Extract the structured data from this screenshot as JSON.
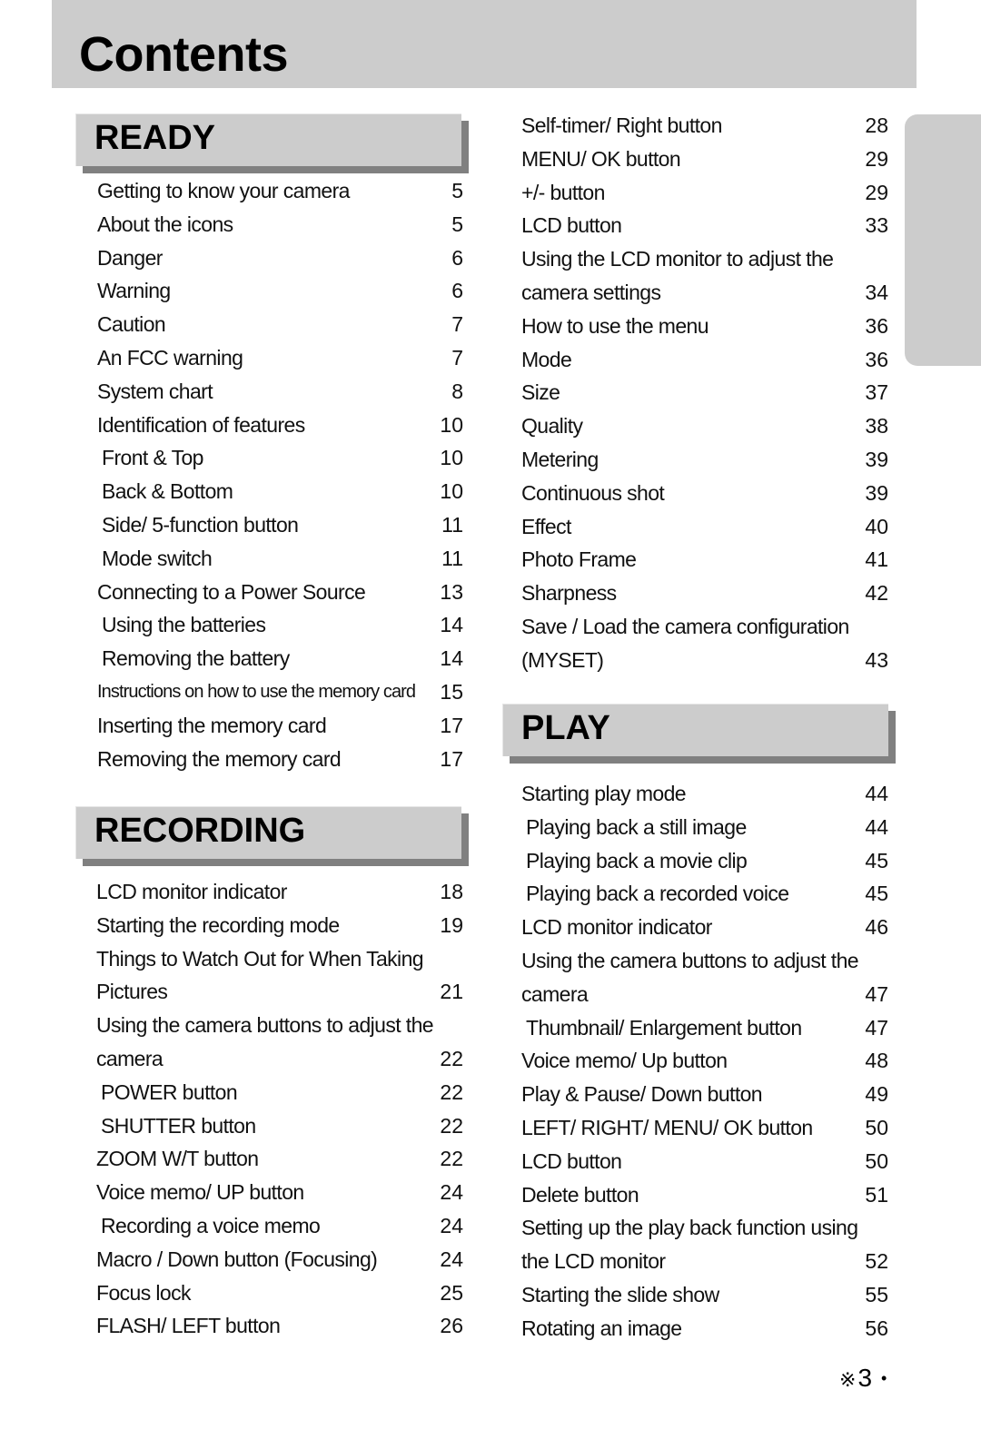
{
  "page_title": "Contents",
  "page_number": "3",
  "footer_mark": "※",
  "footer_bullet": "•",
  "sections": {
    "ready": {
      "title": "READY",
      "items": [
        {
          "text": "Getting to know your camera",
          "page": "5"
        },
        {
          "text": "About the icons",
          "page": "5"
        },
        {
          "text": "Danger",
          "page": "6"
        },
        {
          "text": "Warning",
          "page": "6"
        },
        {
          "text": "Caution",
          "page": "7"
        },
        {
          "text": "An FCC warning",
          "page": "7"
        },
        {
          "text": "System chart",
          "page": "8"
        },
        {
          "text": "Identification of features",
          "page": "10"
        },
        {
          "text": "Front & Top",
          "page": "10"
        },
        {
          "text": "Back & Bottom",
          "page": "10"
        },
        {
          "text": "Side/ 5-function button",
          "page": "11"
        },
        {
          "text": "Mode switch",
          "page": "11"
        },
        {
          "text": "Connecting to a Power Source",
          "page": "13"
        },
        {
          "text": "Using the batteries",
          "page": "14"
        },
        {
          "text": "Removing the battery",
          "page": "14"
        },
        {
          "text": "Instructions on how to use the memory card",
          "page": "15"
        },
        {
          "text": "Inserting the memory card",
          "page": "17"
        },
        {
          "text": "Removing the memory card",
          "page": "17"
        }
      ]
    },
    "recording": {
      "title": "RECORDING",
      "items": [
        {
          "text": "LCD monitor indicator",
          "page": "18"
        },
        {
          "text": "Starting the recording mode",
          "page": "19"
        },
        {
          "text": "Things to Watch Out for When Taking",
          "page": ""
        },
        {
          "text": "Pictures",
          "page": "21"
        },
        {
          "text": "Using the camera buttons to adjust the",
          "page": ""
        },
        {
          "text": "camera",
          "page": "22"
        },
        {
          "text": "POWER button",
          "page": "22"
        },
        {
          "text": "SHUTTER button",
          "page": "22"
        },
        {
          "text": "ZOOM W/T button",
          "page": "22"
        },
        {
          "text": "Voice memo/ UP button",
          "page": "24"
        },
        {
          "text": "Recording a voice memo",
          "page": "24"
        },
        {
          "text": "Macro / Down button (Focusing)",
          "page": "24"
        },
        {
          "text": "Focus lock",
          "page": "25"
        },
        {
          "text": "FLASH/ LEFT button",
          "page": "26"
        }
      ]
    },
    "recording_cont": {
      "items": [
        {
          "text": "Self-timer/ Right button",
          "page": "28"
        },
        {
          "text": "MENU/ OK button",
          "page": "29"
        },
        {
          "text": "+/- button",
          "page": "29"
        },
        {
          "text": "LCD button",
          "page": "33"
        },
        {
          "text": "Using the LCD monitor to adjust the",
          "page": ""
        },
        {
          "text": "camera settings",
          "page": "34"
        },
        {
          "text": "How to use the menu",
          "page": "36"
        },
        {
          "text": "Mode",
          "page": "36"
        },
        {
          "text": "Size",
          "page": "37"
        },
        {
          "text": "Quality",
          "page": "38"
        },
        {
          "text": "Metering",
          "page": "39"
        },
        {
          "text": "Continuous shot",
          "page": "39"
        },
        {
          "text": "Effect",
          "page": "40"
        },
        {
          "text": "Photo Frame",
          "page": "41"
        },
        {
          "text": "Sharpness",
          "page": "42"
        },
        {
          "text": "Save / Load the camera configuration",
          "page": ""
        },
        {
          "text": "(MYSET)",
          "page": "43"
        }
      ]
    },
    "play": {
      "title": "PLAY",
      "items": [
        {
          "text": "Starting play mode",
          "page": "44"
        },
        {
          "text": "Playing back a still image",
          "page": "44"
        },
        {
          "text": "Playing back a movie clip",
          "page": "45"
        },
        {
          "text": "Playing back a recorded voice",
          "page": "45"
        },
        {
          "text": "LCD monitor indicator",
          "page": "46"
        },
        {
          "text": "Using the camera buttons to adjust the",
          "page": ""
        },
        {
          "text": "camera",
          "page": "47"
        },
        {
          "text": "Thumbnail/ Enlargement button",
          "page": "47"
        },
        {
          "text": "Voice memo/ Up button",
          "page": "48"
        },
        {
          "text": "Play & Pause/ Down button",
          "page": "49"
        },
        {
          "text": "LEFT/ RIGHT/ MENU/ OK button",
          "page": "50"
        },
        {
          "text": "LCD button",
          "page": "50"
        },
        {
          "text": "Delete button",
          "page": "51"
        },
        {
          "text": "Setting up the play back function using",
          "page": ""
        },
        {
          "text": "the LCD monitor",
          "page": "52"
        },
        {
          "text": "Starting the slide show",
          "page": "55"
        },
        {
          "text": "Rotating an image",
          "page": "56"
        }
      ]
    }
  }
}
